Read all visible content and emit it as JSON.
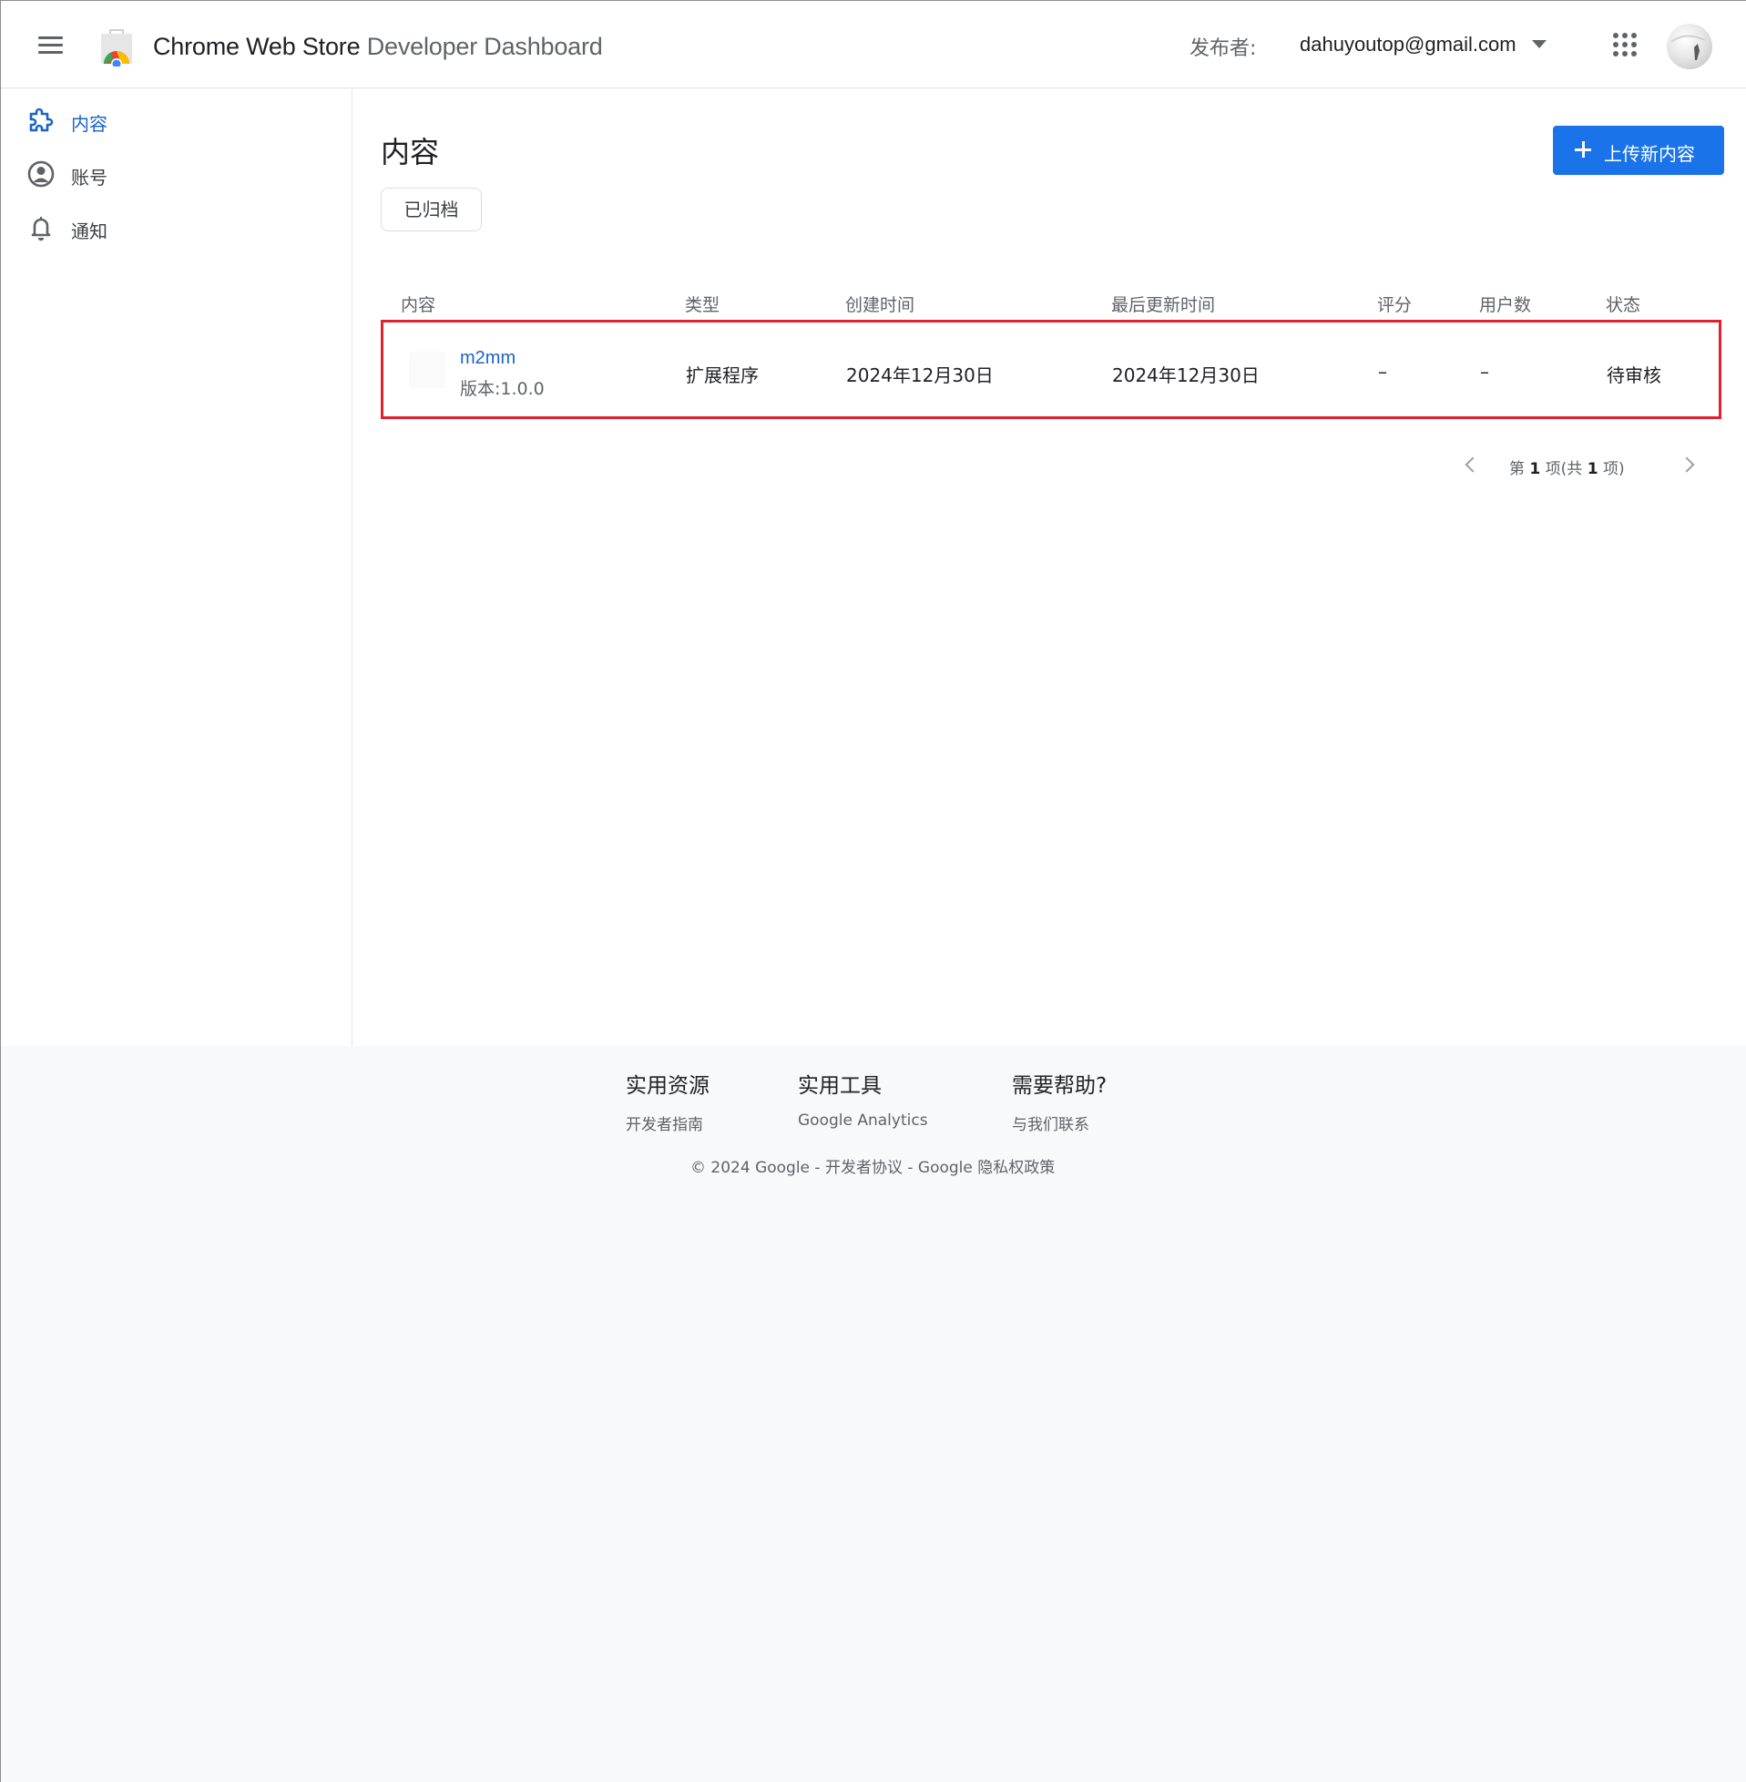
{
  "header": {
    "title_strong": "Chrome Web Store",
    "title_light": "Developer Dashboard",
    "publisher_label": "发布者:",
    "publisher_email": "dahuyoutop@gmail.com"
  },
  "sidebar": {
    "items": [
      {
        "label": "内容",
        "icon": "puzzle-icon",
        "active": true
      },
      {
        "label": "账号",
        "icon": "account-circle-icon",
        "active": false
      },
      {
        "label": "通知",
        "icon": "bell-icon",
        "active": false
      }
    ]
  },
  "main": {
    "title": "内容",
    "archived_label": "已归档",
    "upload_label": "上传新内容",
    "table": {
      "columns": [
        "内容",
        "类型",
        "创建时间",
        "最后更新时间",
        "评分",
        "用户数",
        "状态"
      ],
      "rows": [
        {
          "name": "m2mm",
          "version": "版本:1.0.0",
          "type": "扩展程序",
          "created": "2024年12月30日",
          "updated": "2024年12月30日",
          "rating": "–",
          "users": "–",
          "status": "待审核"
        }
      ]
    },
    "pagination": {
      "prefix": "第",
      "current": "1",
      "middle": "项(共",
      "total": "1",
      "suffix": "项)"
    }
  },
  "footer": {
    "columns": [
      {
        "title": "实用资源",
        "link": "开发者指南"
      },
      {
        "title": "实用工具",
        "link": "Google Analytics"
      },
      {
        "title": "需要帮助?",
        "link": "与我们联系"
      }
    ],
    "copyright": "© 2024 Google - 开发者协议 - Google 隐私权政策"
  },
  "colors": {
    "accent": "#1a73e8",
    "link": "#1a63c9",
    "highlight_border": "#e0222d"
  }
}
